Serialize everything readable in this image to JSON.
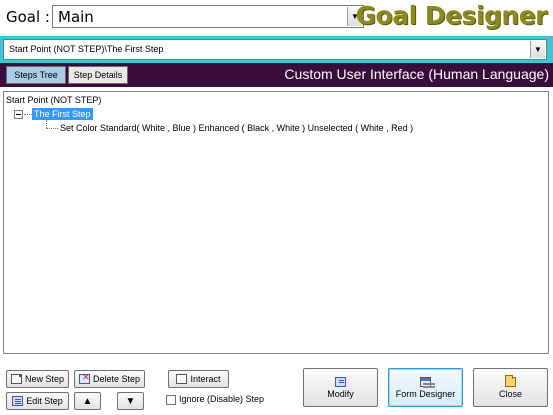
{
  "header": {
    "goal_label": "Goal :",
    "goal_value": "Main",
    "app_title": "Goal Designer"
  },
  "path": {
    "value": "Start Point (NOT STEP)\\The First Step"
  },
  "tabs": [
    {
      "label": "Steps Tree",
      "active": true
    },
    {
      "label": "Step Details",
      "active": false
    }
  ],
  "banner": "Custom User Interface (Human Language)",
  "tree": {
    "root": "Start Point (NOT STEP)",
    "selected": "The First Step",
    "child": "Set Color Standard( White , Blue ) Enhanced ( Black , White ) Unselected ( White , Red )"
  },
  "buttons": {
    "new_step": "New Step",
    "delete_step": "Delete Step",
    "interact": "Interact",
    "edit_step": "Edit Step",
    "ignore_step": "Ignore (Disable) Step",
    "modify": "Modify",
    "form_designer": "Form Designer",
    "close": "Close"
  },
  "icons": {
    "combo_arrow": "chevron-down-icon",
    "move_up": "triangle-up-icon",
    "move_down": "triangle-down-icon"
  },
  "colors": {
    "title": "#8c8a1e",
    "path_band": "#3cc6d6",
    "tab_band": "#3a0c3c",
    "selection": "#3399ff"
  },
  "state": {
    "ignore_checked": false
  }
}
